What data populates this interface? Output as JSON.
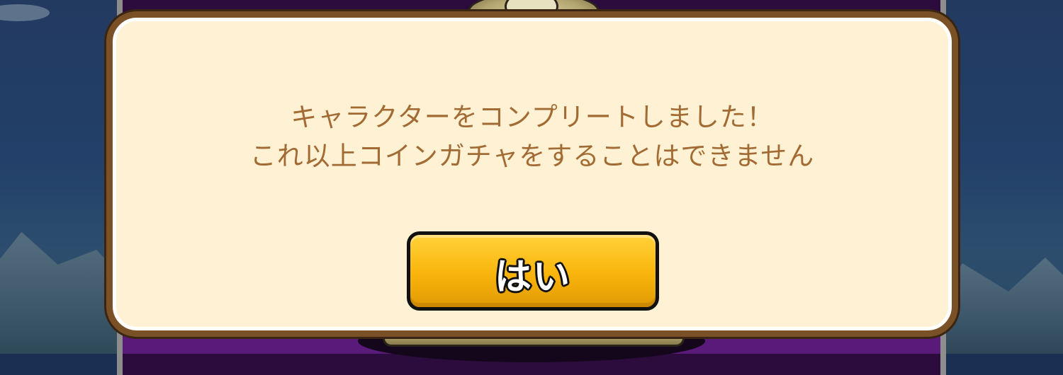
{
  "dialog": {
    "message_line1": "キャラクターをコンプリートしました！",
    "message_line2": "これ以上コインガチャをすることはできません",
    "button_label": "はい"
  },
  "colors": {
    "dialog_bg": "#fff2d4",
    "dialog_border": "#7a5126",
    "message_text": "#a36b34",
    "button_fill": "#f9b40b"
  }
}
